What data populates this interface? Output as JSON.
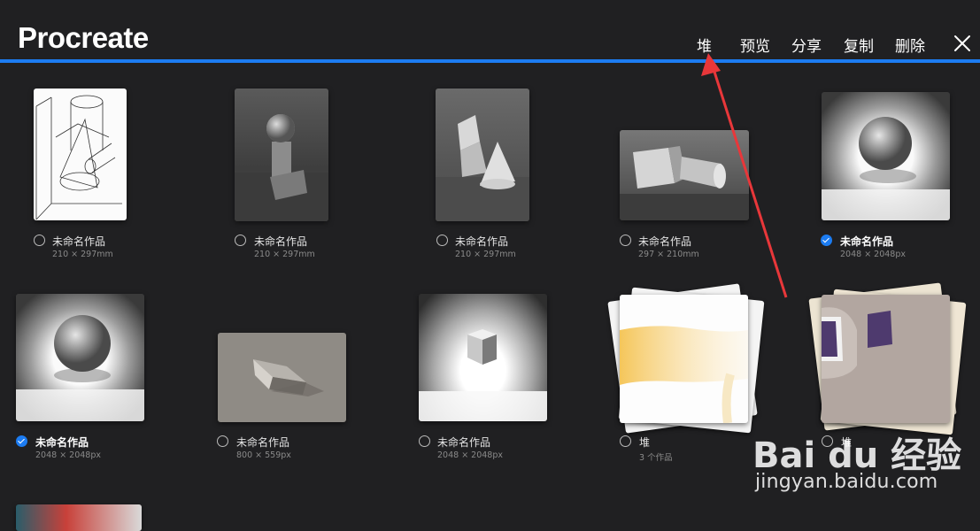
{
  "app": {
    "title": "Procreate"
  },
  "toolbar": {
    "stack_label": "堆",
    "preview_label": "预览",
    "share_label": "分享",
    "duplicate_label": "复制",
    "delete_label": "删除"
  },
  "colors": {
    "accent": "#1c7cf2",
    "annotation_arrow": "#e8373a",
    "background": "#202022"
  },
  "gallery": {
    "items": [
      {
        "name": "未命名作品",
        "dims": "210 × 297mm",
        "selected": false
      },
      {
        "name": "未命名作品",
        "dims": "210 × 297mm",
        "selected": false
      },
      {
        "name": "未命名作品",
        "dims": "210 × 297mm",
        "selected": false
      },
      {
        "name": "未命名作品",
        "dims": "297 × 210mm",
        "selected": false
      },
      {
        "name": "未命名作品",
        "dims": "2048 × 2048px",
        "selected": true
      },
      {
        "name": "未命名作品",
        "dims": "2048 × 2048px",
        "selected": true
      },
      {
        "name": "未命名作品",
        "dims": "800 × 559px",
        "selected": false
      },
      {
        "name": "未命名作品",
        "dims": "2048 × 2048px",
        "selected": false
      },
      {
        "name": "堆",
        "dims": "3 个作品",
        "selected": false
      },
      {
        "name": "堆",
        "dims": "",
        "selected": false
      }
    ]
  },
  "watermark": {
    "logo": "Bai du 经验",
    "url": "jingyan.baidu.com"
  }
}
